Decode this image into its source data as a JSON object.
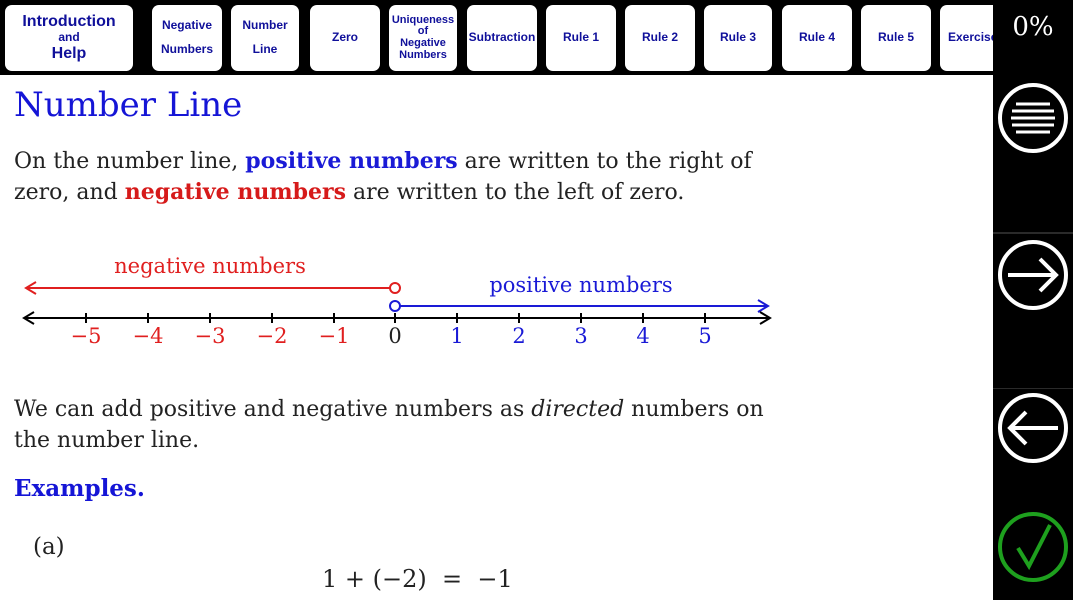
{
  "nav": {
    "tabs": [
      {
        "lines": [
          "Introduction",
          "and",
          "Help"
        ]
      },
      {
        "lines": [
          "Negative",
          "",
          "Numbers"
        ]
      },
      {
        "lines": [
          "Number",
          "",
          "Line"
        ]
      },
      {
        "lines": [
          "Zero"
        ]
      },
      {
        "lines": [
          "Uniqueness",
          "of",
          "Negative",
          "Numbers"
        ]
      },
      {
        "lines": [
          "Subtraction"
        ]
      },
      {
        "lines": [
          "Rule 1"
        ]
      },
      {
        "lines": [
          "Rule 2"
        ]
      },
      {
        "lines": [
          "Rule 3"
        ]
      },
      {
        "lines": [
          "Rule 4"
        ]
      },
      {
        "lines": [
          "Rule 5"
        ]
      },
      {
        "lines": [
          "Exercise"
        ]
      }
    ]
  },
  "sidebar": {
    "progress": "0%",
    "buttons": [
      "menu-icon",
      "arrow-right-icon",
      "arrow-left-icon",
      "checkmark-icon"
    ]
  },
  "main": {
    "title": "Number Line",
    "intro": {
      "part1": "On the number line, ",
      "positive": "positive numbers",
      "part2": " are written to the right of zero, and ",
      "negative": "negative numbers",
      "part3": " are written to the left of zero."
    },
    "numberline": {
      "negative_label": "negative numbers",
      "positive_label": "positive numbers",
      "negative_ticks": [
        "−5",
        "−4",
        "−3",
        "−2",
        "−1"
      ],
      "zero": "0",
      "positive_ticks": [
        "1",
        "2",
        "3",
        "4",
        "5"
      ],
      "negative_color": "#e01f1f",
      "positive_color": "#1a1ad6"
    },
    "directed": {
      "part1": "We can add positive and negative numbers as ",
      "italic": "directed",
      "part2": " numbers on the number line."
    },
    "examples_label": "Examples.",
    "example_a_label": "(a)",
    "example_a_equation": "1 + (−2)  =  −1"
  }
}
